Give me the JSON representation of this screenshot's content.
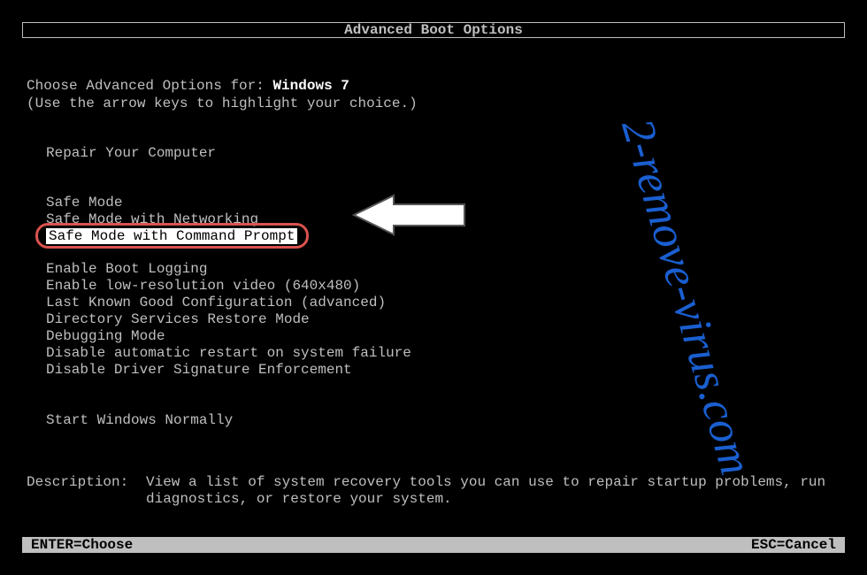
{
  "title": "Advanced Boot Options",
  "choose_prefix": "Choose Advanced Options for: ",
  "os_name": "Windows 7",
  "hint": "(Use the arrow keys to highlight your choice.)",
  "repair": "Repair Your Computer",
  "group1": {
    "item0": "Safe Mode",
    "item1": "Safe Mode with Networking",
    "item2": "Safe Mode with Command Prompt"
  },
  "group2": {
    "item0": "Enable Boot Logging",
    "item1": "Enable low-resolution video (640x480)",
    "item2": "Last Known Good Configuration (advanced)",
    "item3": "Directory Services Restore Mode",
    "item4": "Debugging Mode",
    "item5": "Disable automatic restart on system failure",
    "item6": "Disable Driver Signature Enforcement"
  },
  "start_normal": "Start Windows Normally",
  "description_label": "Description:",
  "description_text": "View a list of system recovery tools you can use to repair startup problems, run diagnostics, or restore your system.",
  "footer_enter": "ENTER=Choose",
  "footer_esc": "ESC=Cancel",
  "watermark_text": "2-remove-virus.com"
}
